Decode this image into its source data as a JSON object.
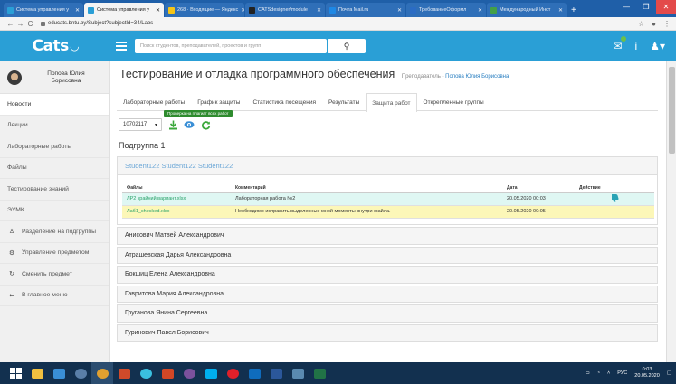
{
  "browser": {
    "tabs": [
      {
        "label": "Система управления у",
        "active": false,
        "color": "#2a9fd6"
      },
      {
        "label": "Система управления у",
        "active": true,
        "color": "#2a9fd6"
      },
      {
        "label": "268 · Входящие — Яндекс",
        "active": false,
        "color": "#f5c518"
      },
      {
        "label": "CATSdesigner/module",
        "active": false,
        "color": "#222222"
      },
      {
        "label": "Почта Mail.ru",
        "active": false,
        "color": "#1e88e5"
      },
      {
        "label": "ТребованиеОформл",
        "active": false,
        "color": "#2b6cc4"
      },
      {
        "label": "Международный Инст",
        "active": false,
        "color": "#43a047"
      }
    ],
    "url": "educats.bntu.by/Subject?subjectId=34/Labs"
  },
  "header": {
    "logo": "Cats",
    "search_placeholder": "Поиск студентов, преподавателей, проектов и групп"
  },
  "sidebar": {
    "profile_name": "Попова Юлия Борисовна",
    "items": [
      {
        "label": "Новости",
        "icon": ""
      },
      {
        "label": "Лекции",
        "icon": ""
      },
      {
        "label": "Лабораторные работы",
        "icon": ""
      },
      {
        "label": "Файлы",
        "icon": ""
      },
      {
        "label": "Тестирование знаний",
        "icon": ""
      },
      {
        "label": "ЭУМК",
        "icon": ""
      },
      {
        "label": "Разделение на подгруппы",
        "icon": "group-icon"
      },
      {
        "label": "Управление предметом",
        "icon": "gear-icon"
      },
      {
        "label": "Сменить предмет",
        "icon": "refresh-icon"
      },
      {
        "label": "В главное меню",
        "icon": "back-arrow-icon"
      }
    ]
  },
  "main": {
    "title": "Тестирование и отладка программного обеспечения",
    "teacher_label": "Преподаватель -",
    "teacher_name": "Попова Юлия Борисовна",
    "tabs": [
      {
        "label": "Лабораторные работы"
      },
      {
        "label": "График защиты"
      },
      {
        "label": "Статистика посещения"
      },
      {
        "label": "Результаты"
      },
      {
        "label": "Защита работ",
        "active": true
      },
      {
        "label": "Открепленные группы"
      }
    ],
    "tooltip": "Проверка на плагиат всех работ",
    "group_value": "10702117",
    "subgroup_title": "Подгруппа 1",
    "student_header": "Student122 Student122 Student122",
    "table": {
      "columns": [
        "Файлы",
        "Комментарий",
        "Дата",
        "Действие"
      ],
      "rows": [
        {
          "file": "ЛР2 крайний вариант.xlsx",
          "comment": "Лабораторная работа №2",
          "date": "20.05.2020 00:03",
          "action_icon": "thumbs-down-icon"
        },
        {
          "file": "Лаб1_checked.xlsx",
          "comment": "Необходимо исправить выделенные мной моменты внутри файла.",
          "date": "20.05.2020 00:05",
          "action_icon": ""
        }
      ]
    },
    "students": [
      "Анисович Матвей Александрович",
      "Атрашевская Дарья Александровна",
      "Бокшиц Елена Александровна",
      "Гавритова Мария Александровна",
      "Груганова Янина Сергеевна",
      "Гуринович Павел Борисович"
    ]
  },
  "taskbar": {
    "lang": "РУС",
    "time": "0:03",
    "date": "20.05.2020"
  }
}
